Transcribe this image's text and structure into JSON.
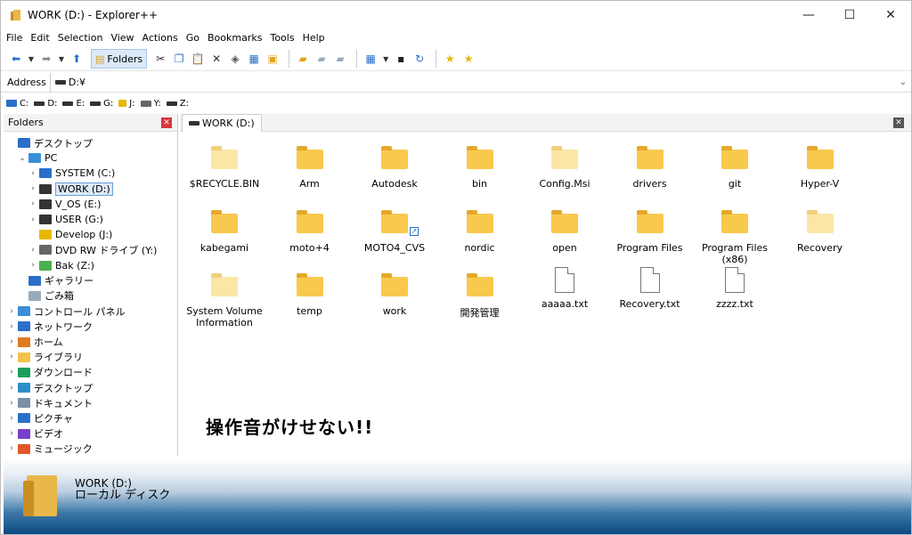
{
  "window": {
    "title": "WORK (D:) - Explorer++",
    "buttons": [
      "—",
      "☐",
      "✕"
    ]
  },
  "menu": [
    "File",
    "Edit",
    "Selection",
    "View",
    "Actions",
    "Go",
    "Bookmarks",
    "Tools",
    "Help"
  ],
  "toolbar": {
    "folders_label": "Folders"
  },
  "address": {
    "label": "Address",
    "value": "D:¥"
  },
  "drives": [
    "C:",
    "D:",
    "E:",
    "G:",
    "J:",
    "Y:",
    "Z:"
  ],
  "folders_pane": {
    "title": "Folders",
    "tree": [
      {
        "label": "デスクトップ",
        "indent": 0,
        "exp": "",
        "icon": "#2a6fc9"
      },
      {
        "label": "PC",
        "indent": 1,
        "exp": "⌄",
        "icon": "#3a8fd9"
      },
      {
        "label": "SYSTEM (C:)",
        "indent": 2,
        "exp": "›",
        "icon": "#2a6fc9"
      },
      {
        "label": "WORK (D:)",
        "indent": 2,
        "exp": "›",
        "icon": "#333",
        "selected": true
      },
      {
        "label": "V_OS (E:)",
        "indent": 2,
        "exp": "›",
        "icon": "#333"
      },
      {
        "label": "USER (G:)",
        "indent": 2,
        "exp": "›",
        "icon": "#333"
      },
      {
        "label": "Develop (J:)",
        "indent": 2,
        "exp": "",
        "icon": "#e6b800"
      },
      {
        "label": "DVD RW ドライブ (Y:)",
        "indent": 2,
        "exp": "›",
        "icon": "#666"
      },
      {
        "label": "Bak (Z:)",
        "indent": 2,
        "exp": "›",
        "icon": "#4caf50"
      },
      {
        "label": "ギャラリー",
        "indent": 1,
        "exp": "",
        "icon": "#2a6fc9"
      },
      {
        "label": "ごみ箱",
        "indent": 1,
        "exp": "",
        "icon": "#9ab"
      },
      {
        "label": "コントロール パネル",
        "indent": 0,
        "exp": "›",
        "icon": "#3a8fd9"
      },
      {
        "label": "ネットワーク",
        "indent": 0,
        "exp": "›",
        "icon": "#2a6fc9"
      },
      {
        "label": "ホーム",
        "indent": 0,
        "exp": "›",
        "icon": "#e07a1f"
      },
      {
        "label": "ライブラリ",
        "indent": 0,
        "exp": "›",
        "icon": "#f2c14e"
      },
      {
        "label": "ダウンロード",
        "indent": 0,
        "exp": "›",
        "icon": "#1e9e5a"
      },
      {
        "label": "デスクトップ",
        "indent": 0,
        "exp": "›",
        "icon": "#2a8fc9"
      },
      {
        "label": "ドキュメント",
        "indent": 0,
        "exp": "›",
        "icon": "#7a8fa8"
      },
      {
        "label": "ピクチャ",
        "indent": 0,
        "exp": "›",
        "icon": "#2a6fc9"
      },
      {
        "label": "ビデオ",
        "indent": 0,
        "exp": "›",
        "icon": "#7a3fc9"
      },
      {
        "label": "ミュージック",
        "indent": 0,
        "exp": "›",
        "icon": "#e0572b"
      }
    ]
  },
  "tab": {
    "label": "WORK (D:)"
  },
  "items": [
    {
      "name": "$RECYCLE.BIN",
      "type": "folder",
      "pale": true
    },
    {
      "name": "Arm",
      "type": "folder"
    },
    {
      "name": "Autodesk",
      "type": "folder"
    },
    {
      "name": "bin",
      "type": "folder"
    },
    {
      "name": "Config.Msi",
      "type": "folder",
      "pale": true
    },
    {
      "name": "drivers",
      "type": "folder"
    },
    {
      "name": "git",
      "type": "folder"
    },
    {
      "name": "Hyper-V",
      "type": "folder"
    },
    {
      "name": "kabegami",
      "type": "folder"
    },
    {
      "name": "moto+4",
      "type": "folder"
    },
    {
      "name": "MOTO4_CVS",
      "type": "folder",
      "shortcut": true
    },
    {
      "name": "nordic",
      "type": "folder"
    },
    {
      "name": "open",
      "type": "folder"
    },
    {
      "name": "Program Files",
      "type": "folder"
    },
    {
      "name": "Program Files (x86)",
      "type": "folder"
    },
    {
      "name": "Recovery",
      "type": "folder",
      "pale": true
    },
    {
      "name": "System Volume Information",
      "type": "folder",
      "pale": true
    },
    {
      "name": "temp",
      "type": "folder"
    },
    {
      "name": "work",
      "type": "folder"
    },
    {
      "name": "開発管理",
      "type": "folder"
    },
    {
      "name": "aaaaa.txt",
      "type": "file"
    },
    {
      "name": "Recovery.txt",
      "type": "file"
    },
    {
      "name": "zzzz.txt",
      "type": "file"
    }
  ],
  "note": "操作音がけせない!!",
  "preview": {
    "name": "WORK (D:)",
    "type": "ローカル ディスク"
  }
}
